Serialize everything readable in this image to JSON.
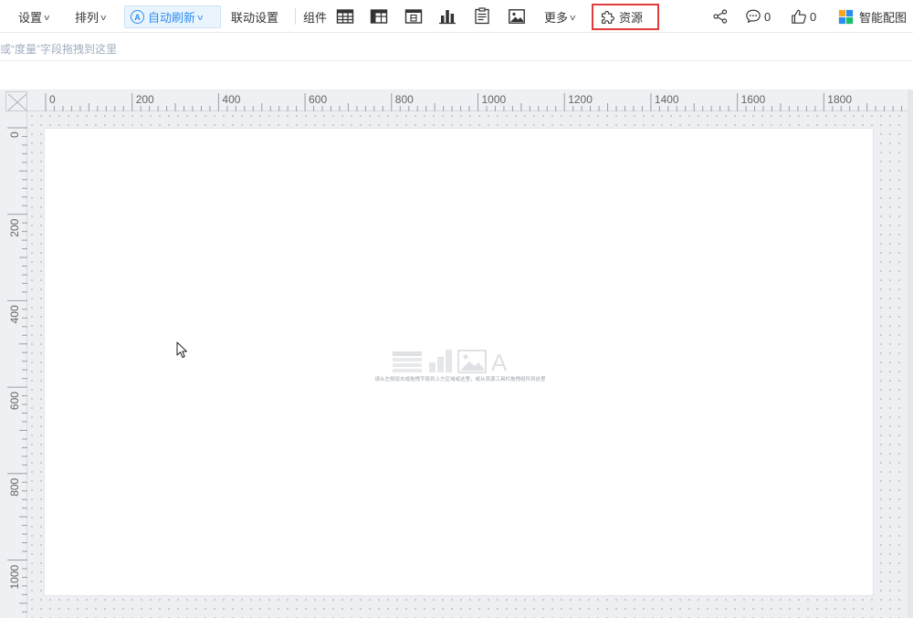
{
  "toolbar": {
    "settings_label": "设置",
    "arrange_label": "排列",
    "auto_refresh_label": "自动刷新",
    "auto_refresh_icon_text": "A",
    "linkage_label": "联动设置",
    "components_label": "组件",
    "more_label": "更多",
    "resources_label": "资源",
    "comments_count": "0",
    "likes_count": "0",
    "smart_chart_label": "智能配图"
  },
  "hint": {
    "text": "或“度量”字段拖拽到这里"
  },
  "ruler": {
    "horizontal_labels": [
      "0",
      "200",
      "400",
      "600",
      "800",
      "1000",
      "1200",
      "1400",
      "1600",
      "1800"
    ],
    "vertical_labels": [
      "0",
      "200",
      "400",
      "600",
      "800",
      "1000"
    ]
  },
  "canvas": {
    "empty_hint": "请从左侧双击或拖拽字段到上方区域或这里，或从资源工具栏拖拽组件到这里",
    "empty_glyph": "A"
  },
  "colors": {
    "accent": "#2d8cf0",
    "highlight_border": "#e03c3c",
    "hint_text": "#a0aec0"
  }
}
